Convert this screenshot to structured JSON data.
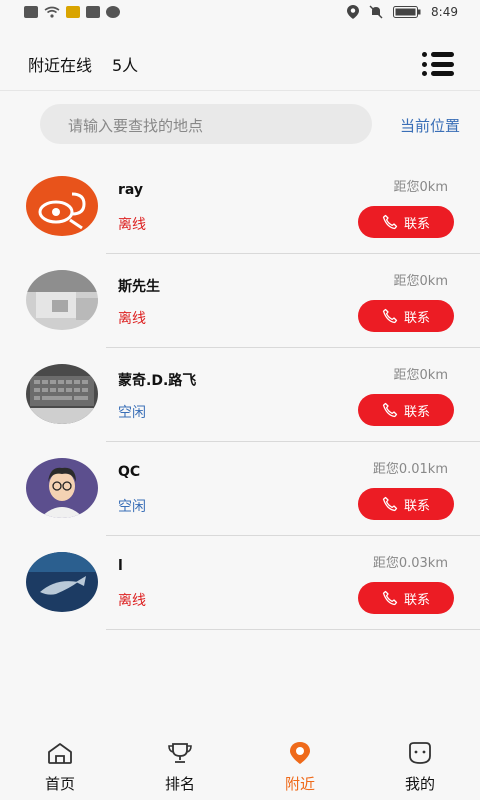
{
  "status_bar": {
    "time": "8:49"
  },
  "header": {
    "title": "附近在线",
    "count": "5人"
  },
  "search": {
    "placeholder": "请输入要查找的地点",
    "location_link": "当前位置"
  },
  "users": [
    {
      "name": "ray",
      "status": "离线",
      "status_type": "offline",
      "distance": "距您0km",
      "call_label": "联系"
    },
    {
      "name": "斯先生",
      "status": "离线",
      "status_type": "offline",
      "distance": "距您0km",
      "call_label": "联系"
    },
    {
      "name": "蒙奇.D.路飞",
      "status": "空闲",
      "status_type": "idle",
      "distance": "距您0km",
      "call_label": "联系"
    },
    {
      "name": "QC",
      "status": "空闲",
      "status_type": "idle",
      "distance": "距您0.01km",
      "call_label": "联系"
    },
    {
      "name": "l",
      "status": "离线",
      "status_type": "offline",
      "distance": "距您0.03km",
      "call_label": "联系"
    }
  ],
  "nav": {
    "items": [
      {
        "label": "首页",
        "icon": "home-icon"
      },
      {
        "label": "排名",
        "icon": "trophy-icon"
      },
      {
        "label": "附近",
        "icon": "location-icon",
        "active": true
      },
      {
        "label": "我的",
        "icon": "profile-icon"
      }
    ]
  },
  "colors": {
    "accent": "#ec1c24",
    "active_nav": "#ef6a1a",
    "link": "#3a6fb7",
    "offline": "#dd2222"
  }
}
